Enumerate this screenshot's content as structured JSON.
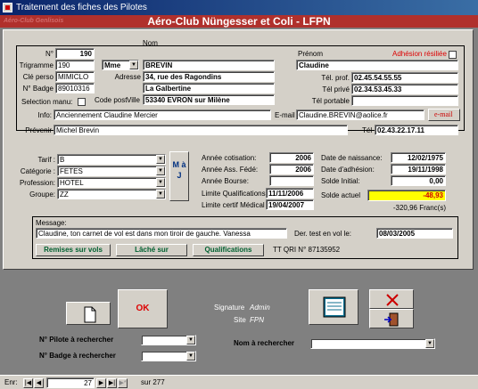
{
  "window": {
    "title": "Traitement des fiches des Pilotes"
  },
  "header": {
    "club_label": "Aéro-Club Genlisois",
    "title": "Aéro-Club Nüngesser et Coli - LFPN"
  },
  "pilot": {
    "num_label": "N°",
    "num": "190",
    "trigramme_label": "Trigramme",
    "trigramme": "190",
    "civilite": "Mme",
    "nom_label": "Nom",
    "nom": "BREVIN",
    "prenom_label": "Prénom",
    "prenom": "Claudine",
    "adhesion_resiliee_label": "Adhésion résiliée",
    "cle_perso_label": "Clé perso",
    "cle_perso": "MIMICLO",
    "adresse_label": "Adresse",
    "adresse1": "34, rue des Ragondins",
    "adresse2": "La Galbertine",
    "badge_label": "N° Badge",
    "badge": "89010316",
    "code_postal_label": "Code post",
    "ville_label": "Ville",
    "ville": "53340 EVRON sur Milène",
    "selection_manu_label": "Selection manu:",
    "tel_prof_label": "Tél. prof.",
    "tel_prof": "02.45.54.55.55",
    "tel_prive_label": "Tél privé",
    "tel_prive": "02.34.53.45.33",
    "tel_portable_label": "Tél portable",
    "tel_portable": "",
    "info_label": "Info:",
    "info": "Anciennement Claudine Mercier",
    "email_label": "E-mail",
    "email": "Claudine.BREVIN@aolice.fr",
    "email_button": "e-mail",
    "prevenir_label": "Prévenir",
    "prevenir": "Michel Brevin",
    "tel_label": "Tél",
    "tel": "02.43.22.17.11"
  },
  "tarifs": {
    "tarif_label": "Tarif :",
    "tarif": "B",
    "categorie_label": "Catégorie :",
    "categorie": "FETES",
    "profession_label": "Profession:",
    "profession": "HOTEL",
    "groupe_label": "Groupe:",
    "groupe": "ZZ",
    "maj_button": "M à J"
  },
  "dates": {
    "cotisation_label": "Année cotisation:",
    "cotisation": "2006",
    "ass_fede_label": "Année Ass. Fédé:",
    "ass_fede": "2006",
    "bourse_label": "Année Bourse:",
    "bourse": "",
    "limite_qualif_label": "Limite Qualifications",
    "limite_qualif": "11/11/2006",
    "limite_medical_label": "Limite certif Médical",
    "limite_medical": "19/04/2007",
    "naissance_label": "Date de naissance:",
    "naissance": "12/02/1975",
    "adhesion_label": "Date d'adhésion:",
    "adhesion": "19/11/1998",
    "solde_initial_label": "Solde Initial:",
    "solde_initial": "0,00",
    "solde_actuel_label": "Solde actuel",
    "solde_actuel": "-48,93",
    "solde_francs": "-320,96 Franc(s)"
  },
  "message": {
    "label": "Message:",
    "text": "Claudine, ton carnet de vol est dans mon tiroir de gauche. Vanessa",
    "der_test_label": "Der. test en vol le:",
    "der_test": "08/03/2005",
    "remises_button": "Remises sur vols",
    "lache_button": "Lâché sur",
    "qualifs_button": "Qualifications",
    "tt_qri": "TT QRI N° 87135952"
  },
  "footer": {
    "ok_button": "OK",
    "signature_label": "Signature",
    "signature": "Admin",
    "site_label": "Site",
    "site": "FPN",
    "pilote_search_label": "N° Pilote à rechercher",
    "badge_search_label": "N° Badge à rechercher",
    "nom_search_label": "Nom à rechercher"
  },
  "status": {
    "enr_label": "Enr:",
    "current": "27",
    "sur": "sur 277"
  }
}
